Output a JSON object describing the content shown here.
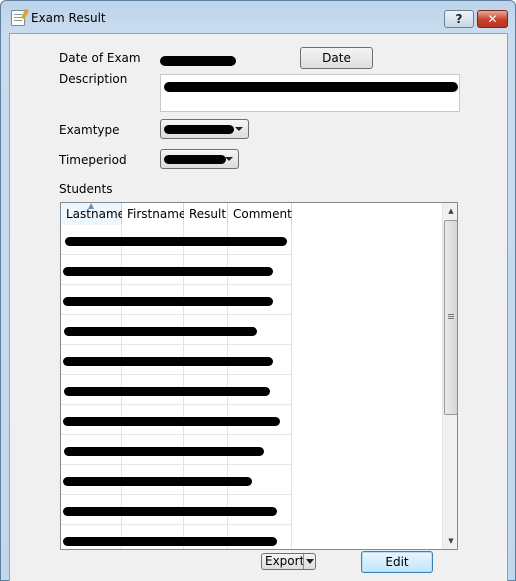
{
  "window": {
    "title": "Exam Result",
    "help_glyph": "?",
    "close_glyph": "✕"
  },
  "form": {
    "date_label": "Date of Exam",
    "date_value": "",
    "date_button": "Date",
    "description_label": "Description",
    "description_value": "",
    "examtype_label": "Examtype",
    "examtype_value": "",
    "timeperiod_label": "Timeperiod",
    "timeperiod_value": "",
    "students_label": "Students"
  },
  "table": {
    "columns": [
      "Lastname",
      "Firstname",
      "Result",
      "Comment"
    ],
    "sorted_column": "Lastname",
    "rows": [
      {
        "lastname": "",
        "firstname": "",
        "result": "",
        "comment": ""
      },
      {
        "lastname": "",
        "firstname": "",
        "result": "",
        "comment": ""
      },
      {
        "lastname": "",
        "firstname": "",
        "result": "",
        "comment": ""
      },
      {
        "lastname": "",
        "firstname": "",
        "result": "",
        "comment": ""
      },
      {
        "lastname": "",
        "firstname": "",
        "result": "",
        "comment": ""
      },
      {
        "lastname": "",
        "firstname": "",
        "result": "",
        "comment": ""
      },
      {
        "lastname": "",
        "firstname": "",
        "result": "",
        "comment": ""
      },
      {
        "lastname": "",
        "firstname": "",
        "result": "",
        "comment": ""
      },
      {
        "lastname": "",
        "firstname": "",
        "result": "",
        "comment": ""
      },
      {
        "lastname": "",
        "firstname": "",
        "result": "",
        "comment": ""
      },
      {
        "lastname": "",
        "firstname": "",
        "result": "",
        "comment": ""
      }
    ]
  },
  "actions": {
    "export_label": "Export",
    "edit_label": "Edit"
  },
  "icons": {
    "app": "exam-document-icon",
    "help": "help-icon",
    "close": "close-icon",
    "sort": "sort-ascending-icon",
    "dropdown": "chevron-down-icon",
    "scroll_up": "scroll-up-icon",
    "scroll_down": "scroll-down-icon"
  },
  "colors": {
    "close_button": "#c7402a",
    "edit_focus": "#3c7fb1",
    "sort_indicator": "#6a8fb8"
  }
}
